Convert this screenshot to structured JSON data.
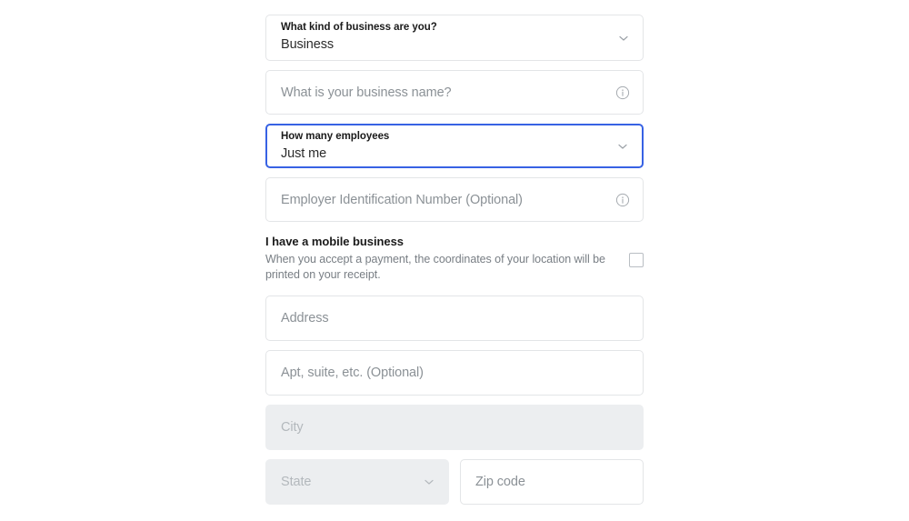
{
  "form": {
    "business_type": {
      "label": "What kind of business are you?",
      "value": "Business",
      "chevron": "chevron-down-icon"
    },
    "business_name": {
      "placeholder": "What is your business name?",
      "value": "",
      "info": "info-icon"
    },
    "employees": {
      "label": "How many employees",
      "value": "Just me",
      "chevron": "chevron-down-icon",
      "focused": true
    },
    "ein": {
      "placeholder": "Employer Identification Number (Optional)",
      "value": "",
      "info": "info-icon"
    },
    "mobile_business": {
      "title": "I have a mobile business",
      "description": "When you accept a payment, the coordinates of your location will be printed on your receipt.",
      "checked": false
    },
    "address": {
      "placeholder": "Address",
      "value": ""
    },
    "apt": {
      "placeholder": "Apt, suite, etc. (Optional)",
      "value": ""
    },
    "city": {
      "placeholder": "City",
      "value": "",
      "disabled": true
    },
    "state": {
      "placeholder": "State",
      "value": "",
      "disabled": true,
      "chevron": "chevron-down-icon"
    },
    "zip": {
      "placeholder": "Zip code",
      "value": ""
    }
  },
  "colors": {
    "page_background": "#ffffff",
    "field_border": "#e3e5e7",
    "focus_border": "#3762e4",
    "disabled_background": "#eceef0",
    "placeholder_text": "#8b9196",
    "label_text": "#1a1a1a",
    "value_text": "#2b2b2b",
    "description_text": "#787e84",
    "icon": "#9aa0a6"
  }
}
